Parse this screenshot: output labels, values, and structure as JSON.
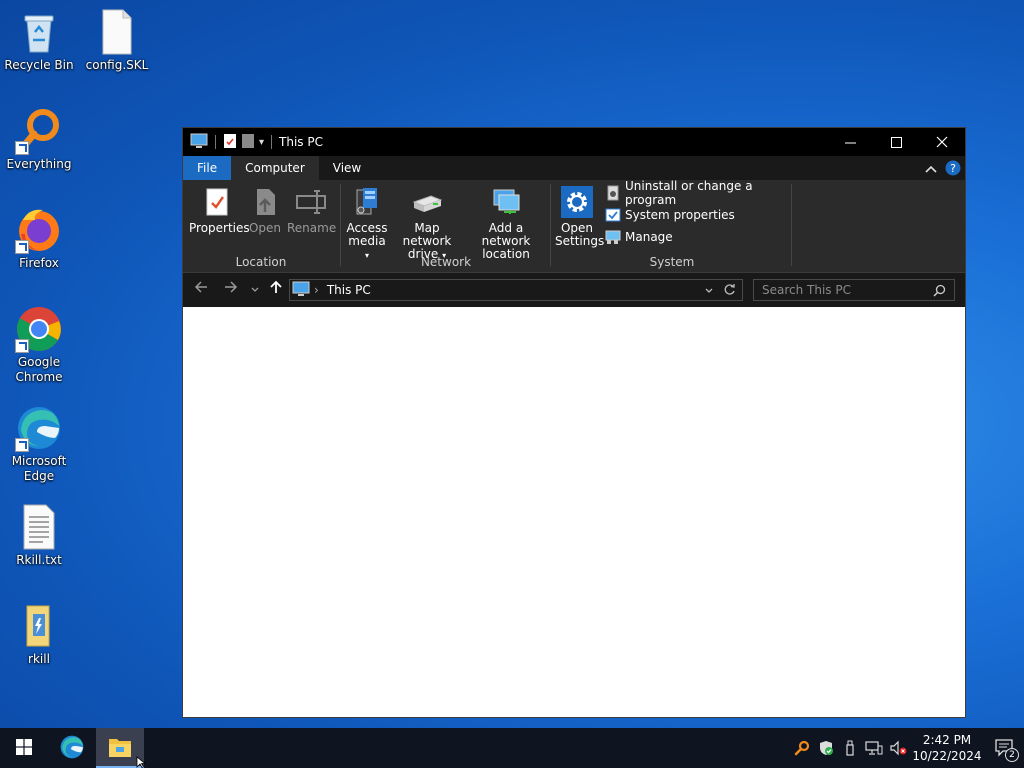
{
  "desktop": {
    "icons": [
      {
        "label": "Recycle Bin",
        "icon": "recycle-bin-icon"
      },
      {
        "label": "config.SKL",
        "icon": "file-icon"
      },
      {
        "label": "Everything",
        "icon": "everything-search-icon"
      },
      {
        "label": "Firefox",
        "icon": "firefox-icon"
      },
      {
        "label": "Google Chrome",
        "icon": "chrome-icon"
      },
      {
        "label": "Microsoft Edge",
        "icon": "edge-icon"
      },
      {
        "label": "Rkill.txt",
        "icon": "text-file-icon"
      },
      {
        "label": "rkill",
        "icon": "folder-icon"
      }
    ]
  },
  "window": {
    "title": "This PC",
    "tabs": {
      "file": "File",
      "computer": "Computer",
      "view": "View"
    },
    "ribbon": {
      "location": {
        "title": "Location",
        "properties": "Properties",
        "open": "Open",
        "rename": "Rename"
      },
      "network": {
        "title": "Network",
        "access_media_1": "Access",
        "access_media_2": "media",
        "map_drive_1": "Map network",
        "map_drive_2": "drive",
        "add_location_1": "Add a network",
        "add_location_2": "location"
      },
      "system": {
        "title": "System",
        "open_settings_1": "Open",
        "open_settings_2": "Settings",
        "uninstall": "Uninstall or change a program",
        "system_properties": "System properties",
        "manage": "Manage"
      }
    },
    "address": {
      "path": "This PC"
    },
    "search": {
      "placeholder": "Search This PC"
    }
  },
  "taskbar": {
    "time": "2:42 PM",
    "date": "10/22/2024",
    "notification_count": "2"
  },
  "colors": {
    "accent": "#1c6bc2",
    "titlebar": "#000000",
    "ribbon": "#2b2b2b"
  }
}
